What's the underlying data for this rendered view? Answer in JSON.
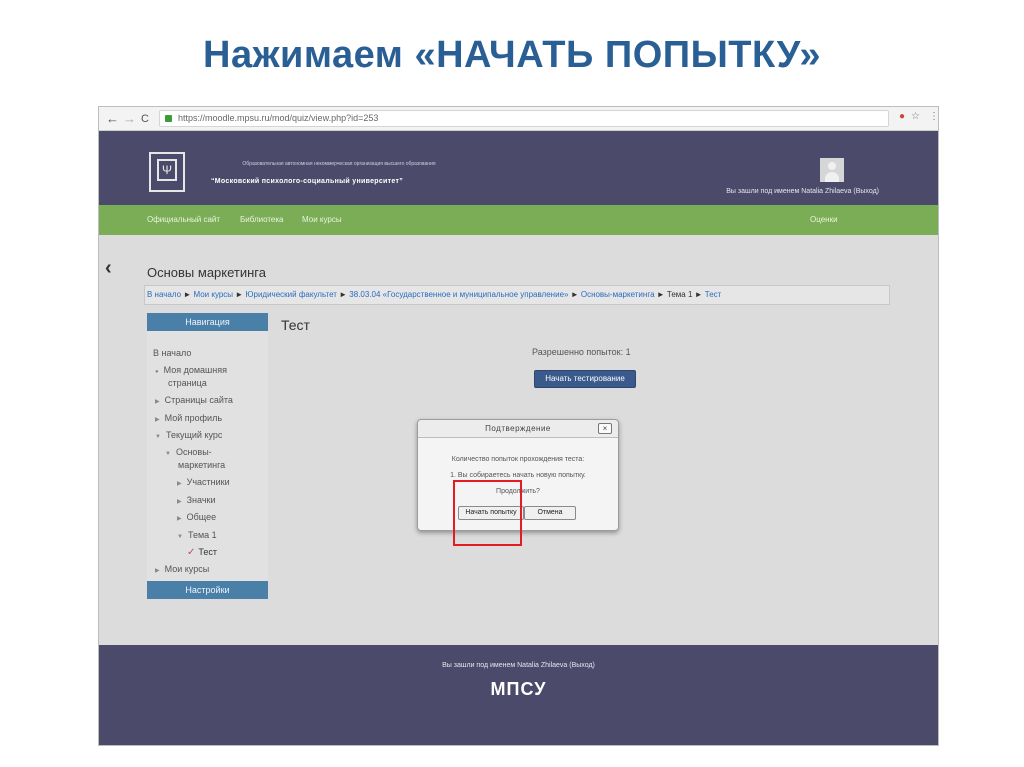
{
  "slide": {
    "title": "Нажимаем «НАЧАТЬ ПОПЫТКУ»"
  },
  "browser": {
    "url": "https://moodle.mpsu.ru/mod/quiz/view.php?id=253",
    "back": "←",
    "forward": "→",
    "reload": "C",
    "menu": "⋮"
  },
  "header": {
    "org_small": "Образовательная автономная некоммерческая организация высшего образования",
    "org_name": "“Московский психолого-социальный университет”",
    "login_info": "Вы зашли под именем Natalia Zhilaeva (Выход)"
  },
  "topnav": {
    "items": [
      "Официальный сайт",
      "Библиотека",
      "Мои курсы"
    ],
    "right": "Оценки"
  },
  "course": {
    "title": "Основы маркетинга"
  },
  "breadcrumb": [
    "В начало",
    "Мои курсы",
    "Юридический факультет",
    "38.03.04 «Государственное и муниципальное управление»",
    "Основы-маркетинга",
    "Тема 1",
    "Тест"
  ],
  "navigation": {
    "header": "Навигация",
    "items": [
      "В начало",
      "Моя домашняя",
      "страница",
      "Страницы сайта",
      "Мой профиль",
      "Текущий курс",
      "Основы-",
      "маркетинга",
      "Участники",
      "Значки",
      "Общее",
      "Тема 1",
      "Тест",
      "Мои курсы"
    ]
  },
  "settings": {
    "header": "Настройки"
  },
  "main": {
    "title": "Тест",
    "allowed": "Разрешенно попыток: 1",
    "start_label": "Начать тестирование"
  },
  "dialog": {
    "title": "Подтверждение",
    "close": "×",
    "line1": "Количество попыток прохождения теста:",
    "line2": "1. Вы собираетесь начать новую попытку.",
    "line3": "Продолжить?",
    "confirm": "Начать попытку",
    "cancel": "Отмена"
  },
  "footer": {
    "login_info": "Вы зашли под именем Natalia Zhilaeva (Выход)",
    "logo": "МПСУ"
  },
  "colors": {
    "header_bg": "#4b4a6a",
    "nav_green": "#7aad55",
    "block_blue": "#4a7fa8",
    "button_blue": "#3a5a8c",
    "highlight_red": "#e51b24",
    "title_blue": "#2a5f95"
  }
}
